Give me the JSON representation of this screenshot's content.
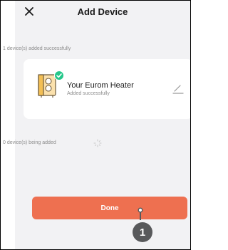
{
  "header": {
    "title": "Add Device",
    "close_icon": "close-icon"
  },
  "added": {
    "summary": "1 device(s) added successfully",
    "device": {
      "name": "Your Eurom Heater",
      "status": "Added successfully",
      "icon": "heater-icon",
      "badge_icon": "check-icon",
      "badge_color": "#25c78a",
      "edit_icon": "edit-pencil-icon"
    }
  },
  "adding": {
    "summary": "0 device(s) being added",
    "icon": "loading-spinner-icon"
  },
  "done_button": {
    "label": "Done",
    "color": "#ee7050"
  },
  "annotation": {
    "number": "1",
    "color": "#58595b"
  }
}
